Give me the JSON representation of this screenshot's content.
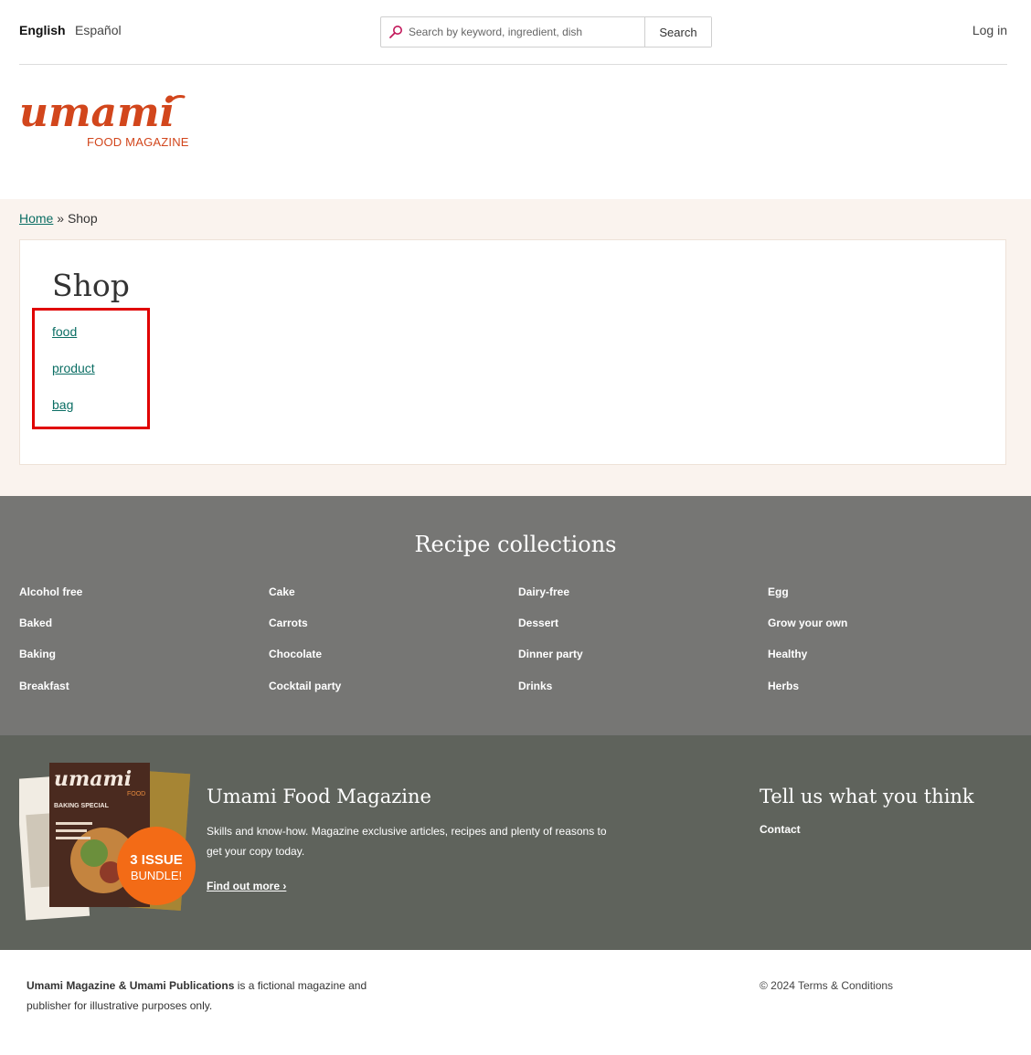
{
  "header": {
    "languages": [
      "English",
      "Español"
    ],
    "search": {
      "placeholder": "Search by keyword, ingredient, dish",
      "button_label": "Search"
    },
    "login_label": "Log in"
  },
  "logo": {
    "wordmark": "umami",
    "tagline": "FOOD MAGAZINE"
  },
  "breadcrumb": {
    "home": "Home",
    "separator": "»",
    "current": "Shop"
  },
  "page": {
    "title": "Shop",
    "links": [
      "food",
      "product",
      "bag"
    ]
  },
  "recipe_collections": {
    "title": "Recipe collections",
    "columns": [
      [
        "Alcohol free",
        "Baked",
        "Baking",
        "Breakfast"
      ],
      [
        "Cake",
        "Carrots",
        "Chocolate",
        "Cocktail party"
      ],
      [
        "Dairy-free",
        "Dessert",
        "Dinner party",
        "Drinks"
      ],
      [
        "Egg",
        "Grow your own",
        "Healthy",
        "Herbs"
      ]
    ]
  },
  "promo": {
    "image": {
      "wordmark": "umami",
      "sub": "FOOD",
      "issue_label": "BAKING SPECIAL",
      "badge_line1": "3 ISSUE",
      "badge_line2": "BUNDLE!"
    },
    "title": "Umami Food Magazine",
    "description": "Skills and know-how. Magazine exclusive articles, recipes and plenty of reasons to get your copy today.",
    "link_label": "Find out more ›",
    "feedback_title": "Tell us what you think",
    "contact_label": "Contact"
  },
  "footer": {
    "brand": "Umami Magazine & Umami Publications",
    "text": " is a fictional magazine and publisher for illustrative purposes only.",
    "copyright": "© 2024",
    "terms_label": "Terms & Conditions"
  },
  "colors": {
    "brand_orange": "#d2461c",
    "link_teal": "#0b6e64",
    "highlight_red": "#e00000",
    "main_bg": "#faf3ee",
    "collections_bg": "#767674",
    "promo_bg": "#5f635c"
  }
}
